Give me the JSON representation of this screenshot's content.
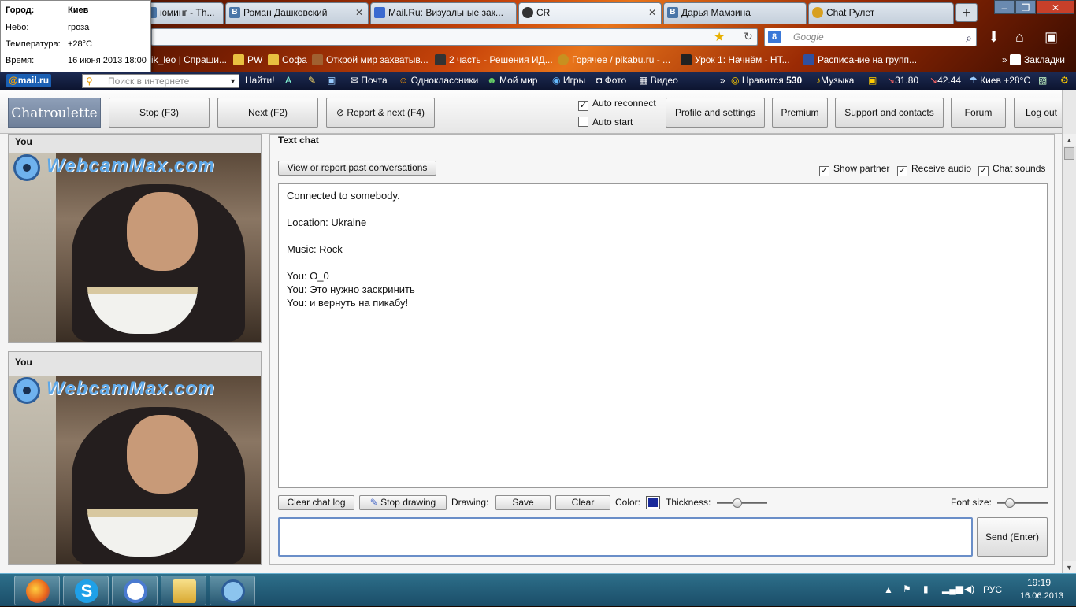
{
  "weather": {
    "city_label": "Город:",
    "city": "Киев",
    "sky_label": "Небо:",
    "sky": "гроза",
    "temp_label": "Температура:",
    "temp": "+28°C",
    "time_label": "Время:",
    "time": "16 июня 2013 18:00"
  },
  "tabs": [
    {
      "label": "юминг - Th...",
      "icon": "tab-icon"
    },
    {
      "label": "Роман Дашковский",
      "icon": "vk-icon"
    },
    {
      "label": "Mail.Ru: Визуальные зак...",
      "icon": "mailru-icon"
    },
    {
      "label": "CR",
      "icon": "chatroulette-icon"
    },
    {
      "label": "Дарья Мамзина",
      "icon": "vk-icon"
    },
    {
      "label": "Chat Рулет",
      "icon": "chat-icon"
    }
  ],
  "search_placeholder": "Google",
  "search_engine_letter": "8",
  "bookmarks": [
    "ik_leo | Спраши...",
    "PW",
    "Софа",
    "Открой мир захватыв...",
    "2 часть - Решения ИД...",
    "Горячее / pikabu.ru - ...",
    "Урок 1: Начнём - НТ...",
    "Расписание на групп...",
    "Закладки"
  ],
  "mailbar": {
    "logo_at": "@",
    "logo_text": "mail.ru",
    "search_placeholder": "Поиск в интернете",
    "find_label": "Найти!",
    "items": [
      "Почта",
      "Одноклассники",
      "Мой мир",
      "Игры",
      "Фото",
      "Видео"
    ],
    "likes_label": "Нравится",
    "likes_count": "530",
    "music": "Музыка",
    "usd": "31.80",
    "eur": "42.44",
    "city_temp": "Киев +28°C"
  },
  "cr": {
    "logo": "Chatroulette",
    "stop": "Stop (F3)",
    "next": "Next (F2)",
    "report": "Report & next (F4)",
    "auto_reconnect": "Auto reconnect",
    "auto_start": "Auto start",
    "profile": "Profile and settings",
    "premium": "Premium",
    "support": "Support and contacts",
    "forum": "Forum",
    "logout": "Log out",
    "video_top_caption": "You",
    "video_bottom_caption": "You",
    "video_watermark": "WebcamMax.com",
    "chat_title": "Text chat",
    "past_conv": "View or report past conversations",
    "show_partner": "Show partner",
    "receive_audio": "Receive audio",
    "chat_sounds": "Chat sounds",
    "chat_lines": [
      "Connected to somebody.",
      "",
      "Location: Ukraine",
      "",
      "Music: Rock",
      "",
      "You: O_0",
      "You: Это нужно заскринить",
      "You: и вернуть на пикабу!"
    ],
    "clear_log": "Clear chat log",
    "stop_drawing": "Stop drawing",
    "drawing_label": "Drawing:",
    "save": "Save",
    "clear": "Clear",
    "color_label": "Color:",
    "thickness_label": "Thickness:",
    "font_size_label": "Font size:",
    "send": "Send (Enter)"
  },
  "taskbar": {
    "lang": "РУС",
    "time": "19:19",
    "date": "16.06.2013"
  }
}
